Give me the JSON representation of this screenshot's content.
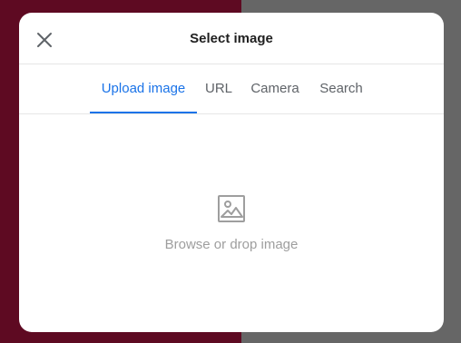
{
  "colors": {
    "backdrop_left": "#5e0a22",
    "backdrop_right": "#666666",
    "accent": "#1a73e8"
  },
  "dialog": {
    "title": "Select image",
    "close_icon": "close-icon"
  },
  "tabs": [
    {
      "label": "Upload image",
      "active": true
    },
    {
      "label": "URL",
      "active": false
    },
    {
      "label": "Camera",
      "active": false
    },
    {
      "label": "Search",
      "active": false
    }
  ],
  "dropzone": {
    "icon": "image-icon",
    "label": "Browse or drop image"
  }
}
